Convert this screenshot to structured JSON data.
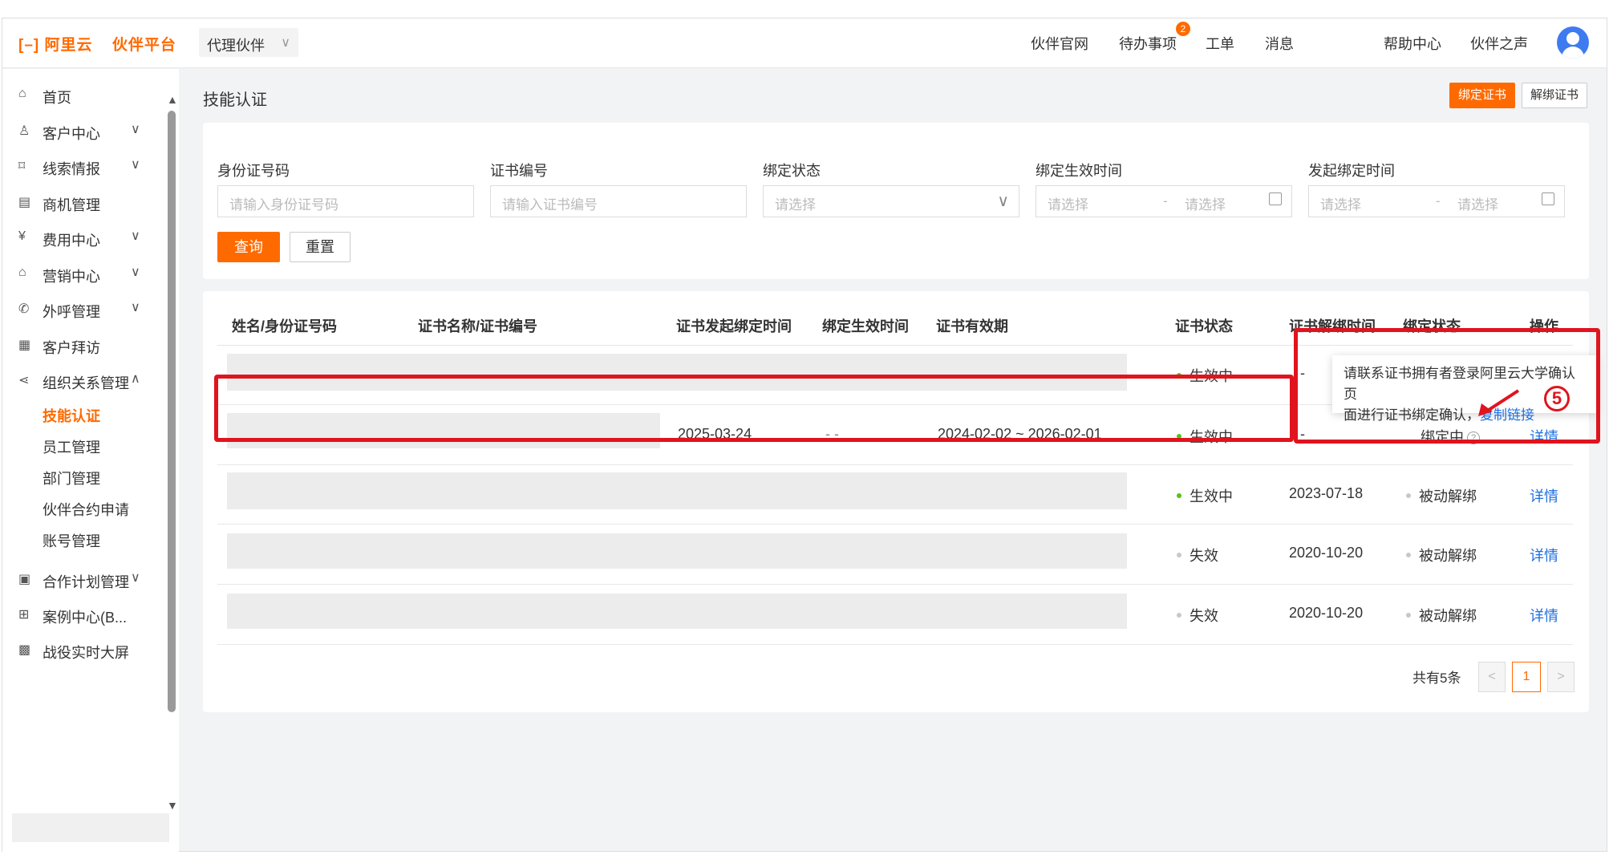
{
  "topbar": {
    "logo_text": "阿里云",
    "platform_text": "伙伴平台",
    "partner_select": "代理伙伴",
    "nav": [
      "伙伴官网",
      "待办事项",
      "工单",
      "消息",
      "",
      "帮助中心",
      "伙伴之声"
    ],
    "todo_badge": "2"
  },
  "sidebar": {
    "items": [
      {
        "icon": "home-icon",
        "glyph": "⌂",
        "label": "首页",
        "arrow": ""
      },
      {
        "icon": "customer-icon",
        "glyph": "♙",
        "label": "客户中心",
        "arrow": "∨"
      },
      {
        "icon": "leads-icon",
        "glyph": "⌑",
        "label": "线索情报",
        "arrow": "∨"
      },
      {
        "icon": "opportunity-icon",
        "glyph": "▤",
        "label": "商机管理",
        "arrow": ""
      },
      {
        "icon": "fee-icon",
        "glyph": "¥",
        "label": "费用中心",
        "arrow": "∨"
      },
      {
        "icon": "marketing-icon",
        "glyph": "⌂",
        "label": "营销中心",
        "arrow": "∨"
      },
      {
        "icon": "call-icon",
        "glyph": "✆",
        "label": "外呼管理",
        "arrow": "∨"
      },
      {
        "icon": "visit-icon",
        "glyph": "▦",
        "label": "客户拜访",
        "arrow": ""
      },
      {
        "icon": "org-icon",
        "glyph": "⋖",
        "label": "组织关系管理",
        "arrow": "∧"
      }
    ],
    "sub_items": [
      "技能认证",
      "员工管理",
      "部门管理",
      "伙伴合约申请",
      "账号管理"
    ],
    "items_bottom": [
      {
        "icon": "plan-icon",
        "glyph": "▣",
        "label": "合作计划管理",
        "arrow": "∨"
      },
      {
        "icon": "case-icon",
        "glyph": "⊞",
        "label": "案例中心(B...",
        "arrow": ""
      },
      {
        "icon": "dashboard-icon",
        "glyph": "▩",
        "label": "战役实时大屏",
        "arrow": ""
      }
    ]
  },
  "page": {
    "title": "技能认证",
    "bind_button": "绑定证书",
    "unbind_button": "解绑证书"
  },
  "filters": {
    "fields": [
      {
        "label": "身份证号码",
        "placeholder": "请输入身份证号码",
        "type": "text"
      },
      {
        "label": "证书编号",
        "placeholder": "请输入证书编号",
        "type": "text"
      },
      {
        "label": "绑定状态",
        "placeholder": "请选择",
        "type": "select"
      },
      {
        "label": "绑定生效时间",
        "placeholder": "请选择",
        "placeholder2": "请选择",
        "type": "range"
      },
      {
        "label": "发起绑定时间",
        "placeholder": "请选择",
        "placeholder2": "请选择",
        "type": "range"
      }
    ],
    "query_button": "查询",
    "reset_button": "重置"
  },
  "table": {
    "columns": [
      "姓名/身份证号码",
      "证书名称/证书编号",
      "证书发起绑定时间",
      "绑定生效时间",
      "证书有效期",
      "证书状态",
      "证书解绑时间",
      "绑定状态",
      "操作"
    ],
    "rows": [
      {
        "initiate_time": "",
        "effective_time": "",
        "validity": "",
        "cert_status": "生效中",
        "cert_status_color": "green",
        "unbind_time": "-",
        "bind_status": "",
        "action": ""
      },
      {
        "initiate_time": "2025-03-24",
        "effective_time": "- -",
        "validity": "2024-02-02 ~ 2026-02-01",
        "cert_status": "生效中",
        "cert_status_color": "green",
        "unbind_time": "-",
        "bind_status": "绑定中",
        "action": "详情"
      },
      {
        "initiate_time": "",
        "effective_time": "",
        "validity": "",
        "cert_status": "生效中",
        "cert_status_color": "green",
        "unbind_time": "2023-07-18",
        "bind_status": "被动解绑",
        "action": "详情"
      },
      {
        "initiate_time": "",
        "effective_time": "",
        "validity": "",
        "cert_status": "失效",
        "cert_status_color": "grey",
        "unbind_time": "2020-10-20",
        "bind_status": "被动解绑",
        "action": "详情"
      },
      {
        "initiate_time": "",
        "effective_time": "",
        "validity": "",
        "cert_status": "失效",
        "cert_status_color": "grey",
        "unbind_time": "2020-10-20",
        "bind_status": "被动解绑",
        "action": "详情"
      }
    ],
    "total_text": "共有5条",
    "current_page": "1"
  },
  "tooltip": {
    "line1": "请联系证书拥有者登录阿里云大学确认页",
    "line2": "面进行证书绑定确认，",
    "link": "复制链接"
  },
  "annotation": {
    "step": "5",
    "step_glyph": "⑤",
    "highlight_color": "#e0141e"
  },
  "colors": {
    "accent": "#ff6a00",
    "link": "#1e6fe0",
    "active_status": "#52c41a"
  }
}
